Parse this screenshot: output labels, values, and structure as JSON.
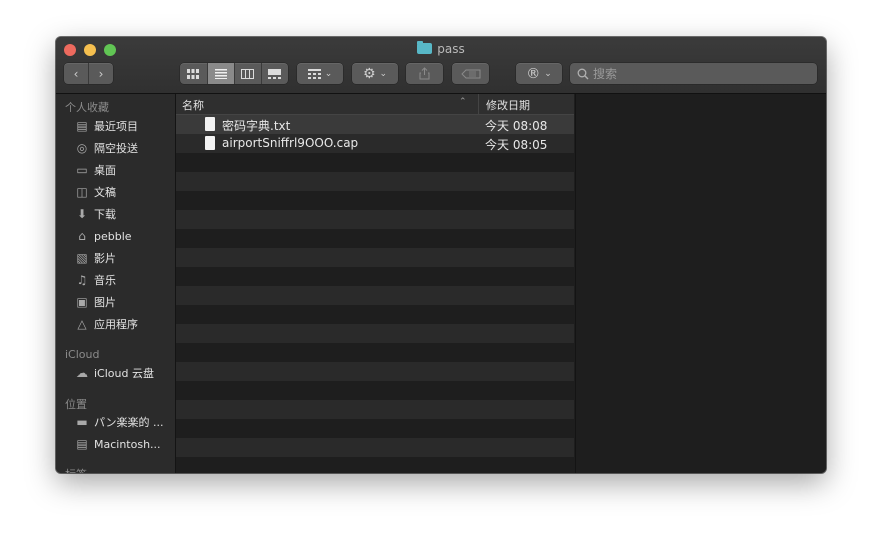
{
  "window": {
    "title": "pass"
  },
  "toolbar": {
    "search_placeholder": "搜索"
  },
  "sidebar": {
    "favorites_header": "个人收藏",
    "favorites": [
      {
        "label": "最近项目",
        "icon": "clock-icon"
      },
      {
        "label": "隔空投送",
        "icon": "airdrop-icon"
      },
      {
        "label": "桌面",
        "icon": "desktop-icon"
      },
      {
        "label": "文稿",
        "icon": "documents-icon"
      },
      {
        "label": "下载",
        "icon": "download-icon"
      },
      {
        "label": "pebble",
        "icon": "home-icon"
      },
      {
        "label": "影片",
        "icon": "movies-icon"
      },
      {
        "label": "音乐",
        "icon": "music-icon"
      },
      {
        "label": "图片",
        "icon": "pictures-icon"
      },
      {
        "label": "应用程序",
        "icon": "applications-icon"
      }
    ],
    "icloud_header": "iCloud",
    "icloud_item": "iCloud 云盘",
    "locations_header": "位置",
    "locations": [
      "パン楽楽的 ...",
      "Macintosh..."
    ],
    "tags_header": "标签"
  },
  "list": {
    "col_name": "名称",
    "col_date": "修改日期",
    "files": [
      {
        "name": "密码字典.txt",
        "date": "今天 08:08"
      },
      {
        "name": "airportSniffrl9OOO.cap",
        "date": "今天 08:05"
      }
    ]
  }
}
